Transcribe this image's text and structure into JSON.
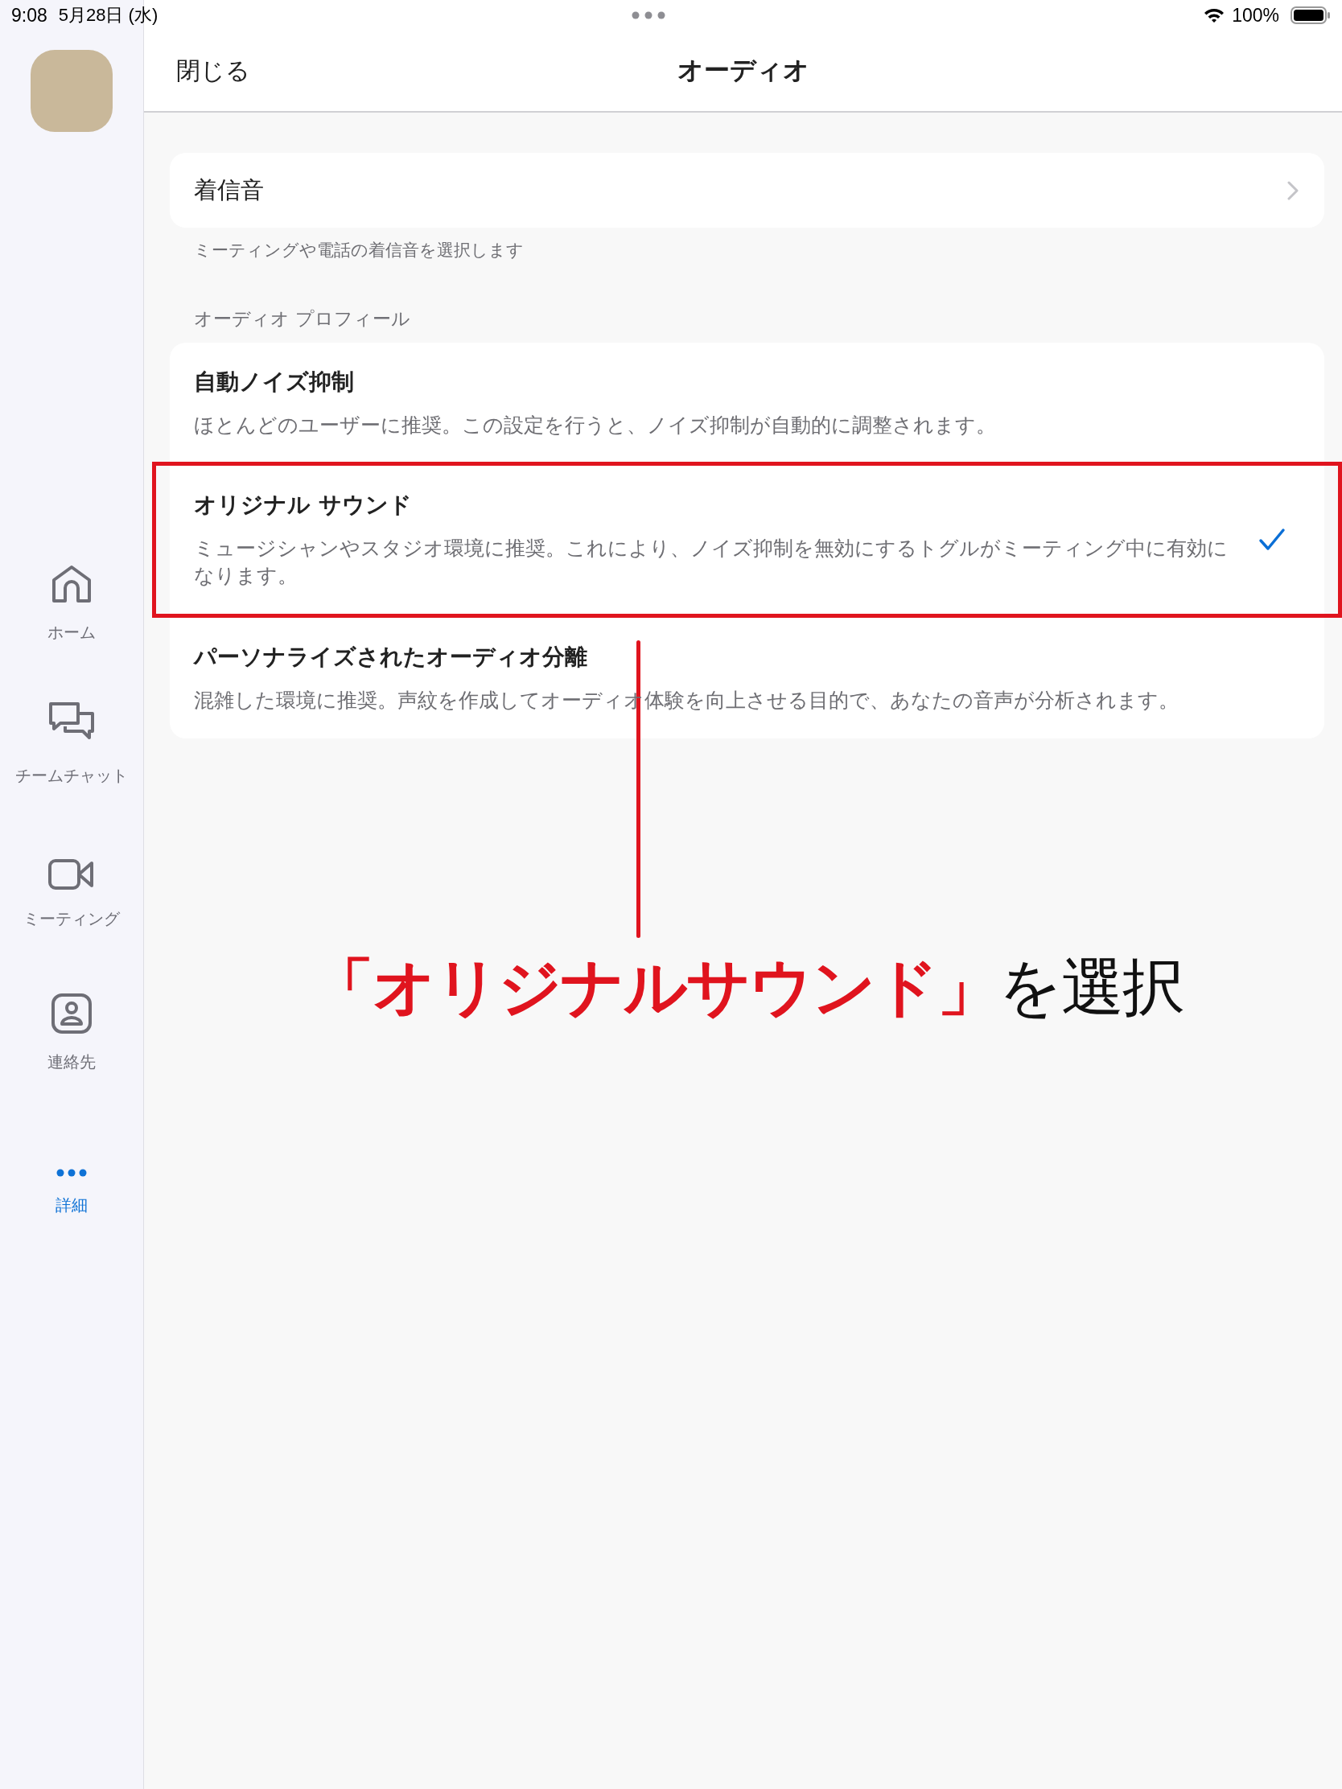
{
  "status_bar": {
    "time": "9:08",
    "date": "5月28日 (水)",
    "battery": "100%"
  },
  "sidebar": {
    "items": [
      {
        "label": "ホーム",
        "kind": "home",
        "selected": false
      },
      {
        "label": "チームチャット",
        "kind": "chat",
        "selected": false
      },
      {
        "label": "ミーティング",
        "kind": "video",
        "selected": false
      },
      {
        "label": "連絡先",
        "kind": "contact",
        "selected": false
      },
      {
        "label": "詳細",
        "kind": "more",
        "selected": true
      }
    ]
  },
  "nav": {
    "close": "閉じる",
    "title": "オーディオ"
  },
  "ringtone": {
    "label": "着信音",
    "caption": "ミーティングや電話の着信音を選択します"
  },
  "profile": {
    "header": "オーディオ プロフィール",
    "options": [
      {
        "title": "自動ノイズ抑制",
        "description": "ほとんどのユーザーに推奨。この設定を行うと、ノイズ抑制が自動的に調整されます。",
        "selected": false,
        "highlighted": false
      },
      {
        "title": "オリジナル サウンド",
        "description": "ミュージシャンやスタジオ環境に推奨。これにより、ノイズ抑制を無効にするトグルがミーティング中に有効になります。",
        "selected": true,
        "highlighted": true
      },
      {
        "title": "パーソナライズされたオーディオ分離",
        "description": "混雑した環境に推奨。声紋を作成してオーディオ体験を向上させる目的で、あなたの音声が分析されます。",
        "selected": false,
        "highlighted": false
      }
    ]
  },
  "annotation": {
    "highlight": "「オリジナルサウンド」",
    "text": "を選択"
  }
}
